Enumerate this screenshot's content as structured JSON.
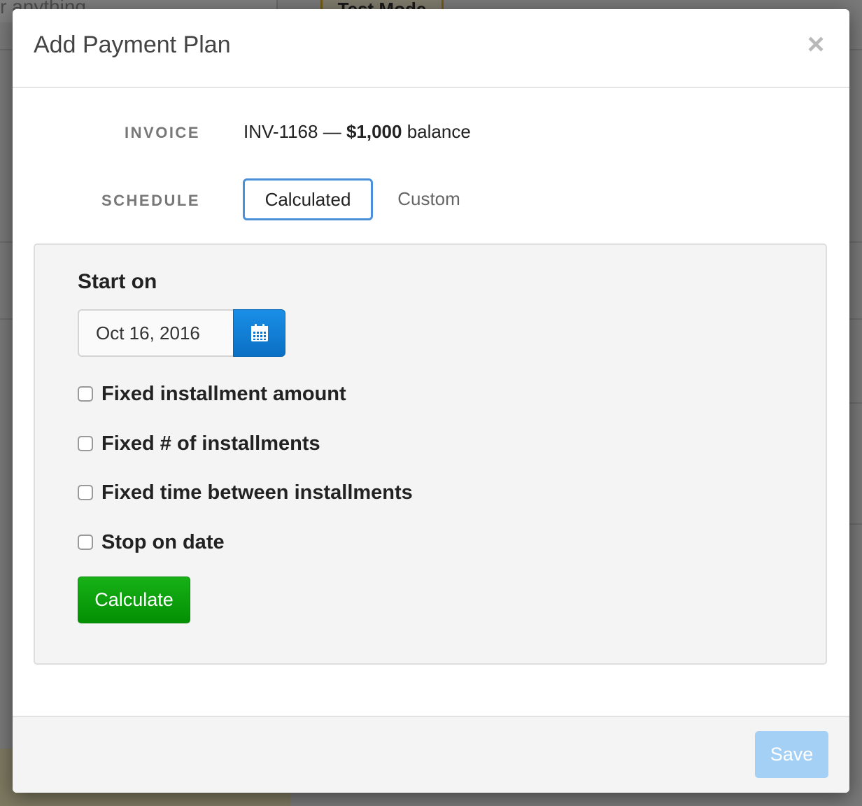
{
  "background": {
    "search_placeholder": "r anything",
    "test_mode_label": "Test Mode"
  },
  "modal": {
    "title": "Add Payment Plan",
    "close_symbol": "×",
    "invoice": {
      "label": "INVOICE",
      "number": "INV-1168",
      "separator": "—",
      "amount": "$1,000",
      "suffix": "balance"
    },
    "schedule": {
      "label": "SCHEDULE",
      "tabs": [
        {
          "label": "Calculated",
          "active": true
        },
        {
          "label": "Custom",
          "active": false
        }
      ]
    },
    "calculator": {
      "start_label": "Start on",
      "start_date": "Oct 16, 2016",
      "calendar_icon": "calendar-icon",
      "options": [
        {
          "label": "Fixed installment amount",
          "checked": false
        },
        {
          "label": "Fixed # of installments",
          "checked": false
        },
        {
          "label": "Fixed time between installments",
          "checked": false
        },
        {
          "label": "Stop on date",
          "checked": false
        }
      ],
      "calculate_label": "Calculate"
    },
    "footer": {
      "save_label": "Save"
    }
  },
  "colors": {
    "primary_blue": "#0a6fc4",
    "success_green": "#039003",
    "save_disabled": "#a4d0f5"
  }
}
